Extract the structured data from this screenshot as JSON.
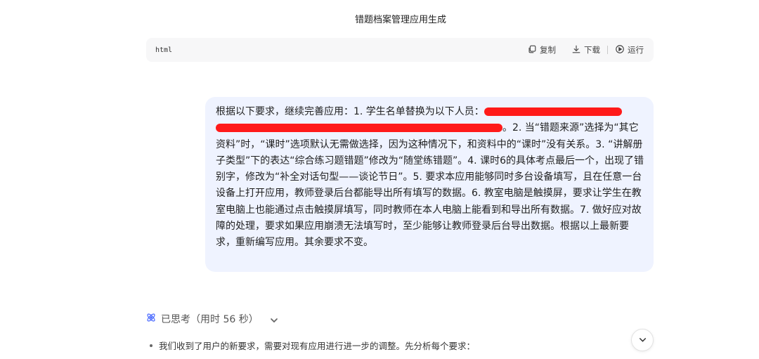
{
  "header": {
    "title": "错题档案管理应用生成"
  },
  "code_block": {
    "language": "html",
    "copy_label": "复制",
    "download_label": "下载",
    "run_label": "运行"
  },
  "user_message": {
    "segment_1": "根据以下要求，继续完善应用：1. 学生名单替换为以下人员：",
    "segment_2": "。2. 当“错题来源”选择为“其它资料”时，“课时”选项默认无需做选择，因为这种情况下，和资料中的“课时”没有关系。3. “讲解册子类型”下的表达“综合练习题错题”修改为“随堂练错题”。4. 课时6的具体考点最后一个，出现了错别字，修改为“补全对话句型——谈论节日”。5. 要求本应用能够同时多台设备填写，且在任意一台设备上打开应用，教师登录后台都能导出所有填写的数据。6. 教室电脑是触摸屏，要求让学生在教室电脑上也能通过点击触摸屏填写，同时教师在本人电脑上能看到和导出所有数据。7. 做好应对故障的处理，要求如果应用崩溃无法填写时，至少能够让教师登录后台导出数据。根据以上最新要求，重新编写应用。其余要求不变。"
  },
  "thinking": {
    "label": "已思考（用时 56 秒）"
  },
  "reasoning": {
    "first_line": "我们收到了用户的新要求，需要对现有应用进行进一步的调整。先分析每个要求："
  },
  "icons": {
    "copy": "copy-icon",
    "download": "download-icon",
    "run": "play-circle-icon",
    "thinking": "atom-icon",
    "expand": "chevron-down-icon",
    "scroll": "arrow-down-icon"
  },
  "colors": {
    "bubble_bg": "#eff3ff",
    "redaction": "#ff1a1a",
    "think_icon": "#4b6bff"
  }
}
